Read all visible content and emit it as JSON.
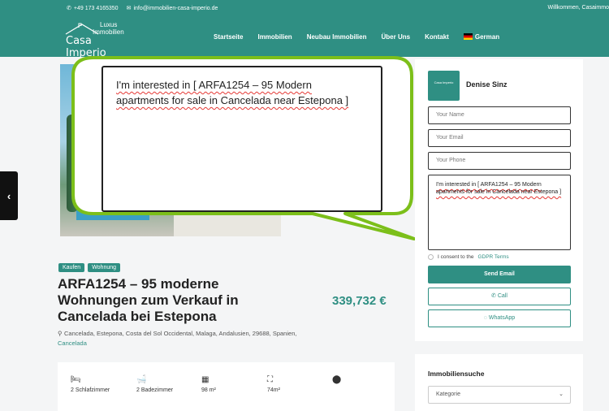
{
  "header": {
    "phone": "+49 173 4165350",
    "email": "info@immobilien-casa-imperio.de",
    "welcome": "Willkommen, Casaimmo",
    "logo": {
      "line1": "Luxus",
      "line2": "Immobilien",
      "line3": "Casa Imperio"
    },
    "nav": [
      "Startseite",
      "Immobilien",
      "Neubau Immobilien",
      "Über Uns",
      "Kontakt"
    ],
    "language": "German",
    "brand_color": "#2f8f83"
  },
  "bubble": {
    "text_line1": "I'm interested in [ ARFA1254 – 95 Modern",
    "text_line2": "apartments for sale in Cancelada near Estepona ]"
  },
  "listing": {
    "tags": [
      "Kaufen",
      "Wohnung"
    ],
    "title": "ARFA1254 – 95 moderne Wohnungen zum Verkauf in Cancelada bei Estepona",
    "price": "339,732 €",
    "address": "Cancelada, Estepona, Costa del Sol Occidental, Malaga, Andalusien, 29688, Spanien,",
    "address_link": "Cancelada",
    "features": {
      "bedrooms": "2 Schlafzimmer",
      "bathrooms": "2 Badezimmer",
      "area1": "98 m²",
      "area2": "74m²"
    }
  },
  "contact": {
    "agent_name": "Denise Sinz",
    "name_placeholder": "Your Name",
    "email_placeholder": "Your Email",
    "phone_placeholder": "Your Phone",
    "message": "I'm interested in [ ARFA1254 – 95 Modern apartments for sale in Cancelada near Estepona ]",
    "consent_text": "I consent to the",
    "consent_link": "GDPR Terms",
    "send_label": "Send Email",
    "call_label": "Call",
    "whatsapp_label": "WhatsApp"
  },
  "search": {
    "title": "Immobiliensuche",
    "category_label": "Kategorie"
  }
}
